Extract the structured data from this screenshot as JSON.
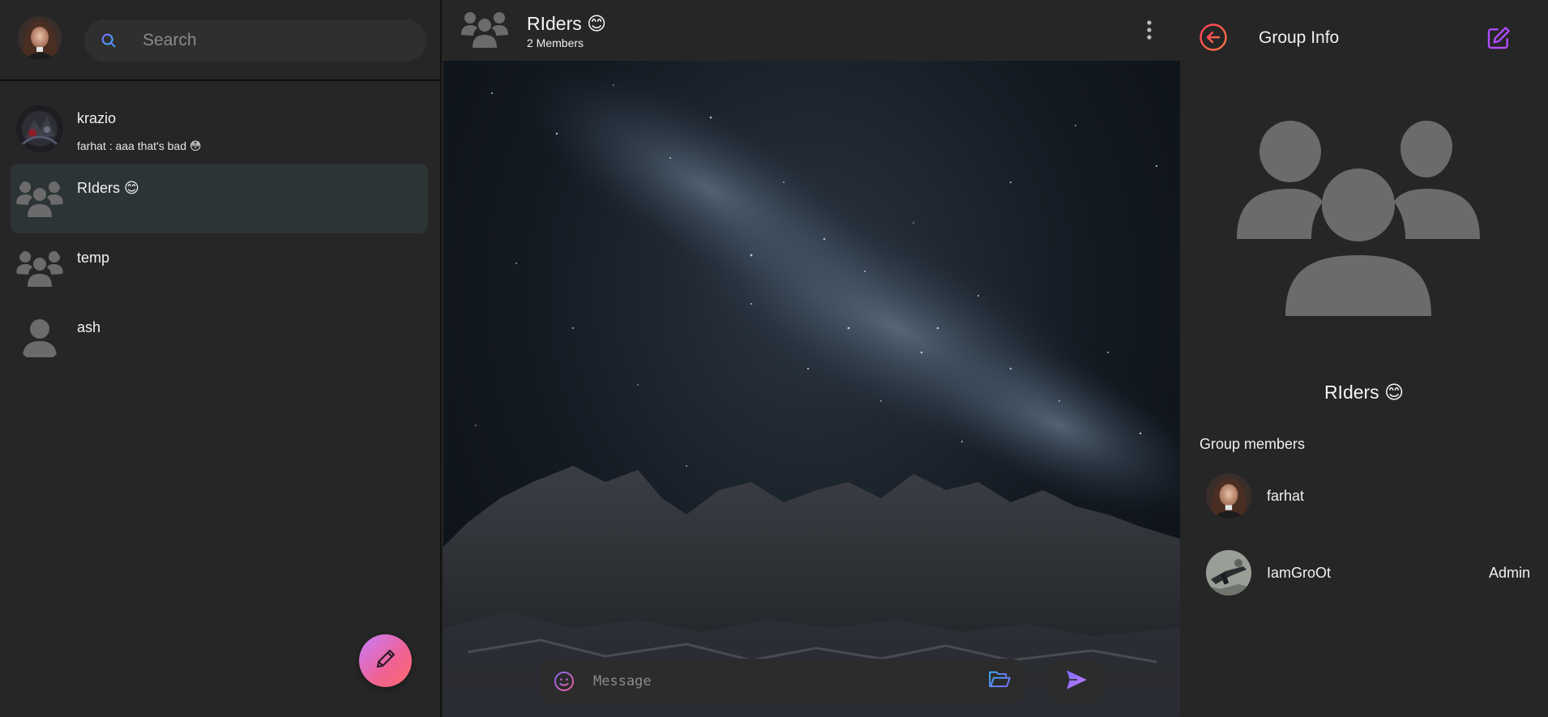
{
  "search": {
    "placeholder": "Search"
  },
  "chats": [
    {
      "name": "krazio",
      "preview": "farhat : aaa that's bad 😳",
      "avatar": "photo"
    },
    {
      "name": "RIders 😊",
      "preview": "",
      "avatar": "group-icon",
      "active": true
    },
    {
      "name": "temp",
      "preview": "",
      "avatar": "group-icon"
    },
    {
      "name": "ash",
      "preview": "",
      "avatar": "person-icon"
    }
  ],
  "fab": {
    "icon": "pencil-icon"
  },
  "chat_header": {
    "title": "RIders 😊",
    "subtitle": "2 Members"
  },
  "composer": {
    "placeholder": "Message"
  },
  "group_info": {
    "title": "Group Info",
    "group_name": "RIders 😊",
    "members_label": "Group members",
    "members": [
      {
        "name": "farhat",
        "role": ""
      },
      {
        "name": "IamGroOt",
        "role": "Admin"
      }
    ]
  },
  "colors": {
    "accent_gradient_start": "#c77dff",
    "accent_gradient_end": "#ff6b6b",
    "back_icon": "#ff4d6d",
    "edit_icon": "#b14cff",
    "icon_gray": "#6b6b6b"
  }
}
